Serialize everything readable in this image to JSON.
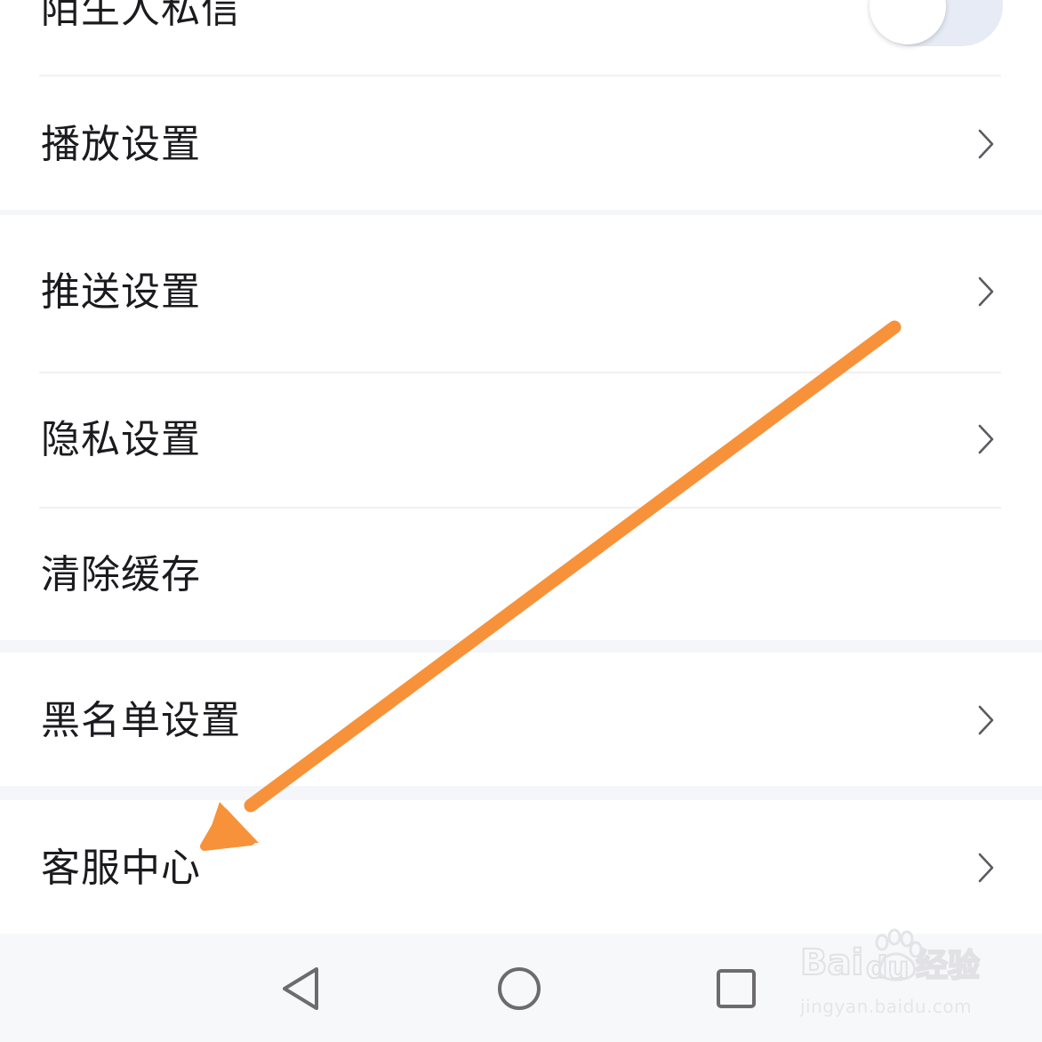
{
  "settings": {
    "stranger_message": {
      "label": "陌生人私信",
      "enabled": false
    },
    "items": [
      {
        "label": "播放设置",
        "has_chevron": true
      },
      {
        "label": "推送设置",
        "has_chevron": true
      },
      {
        "label": "隐私设置",
        "has_chevron": true
      },
      {
        "label": "清除缓存",
        "has_chevron": false
      },
      {
        "label": "黑名单设置",
        "has_chevron": true
      },
      {
        "label": "客服中心",
        "has_chevron": true
      }
    ]
  },
  "navigation_bar": {
    "buttons": [
      "back-icon",
      "home-icon",
      "recent-apps-icon"
    ]
  },
  "annotation": {
    "arrow_color": "#F7923A"
  },
  "watermark": {
    "logo_text": "Baidu经验",
    "url_text": "jingyan.baidu.com"
  },
  "colors": {
    "text": "#1B1B1F",
    "chevron": "#5A5A60",
    "divider": "#F0F1F5",
    "section_gap": "#F5F6F9",
    "toggle_track": "#E6EBF5"
  }
}
